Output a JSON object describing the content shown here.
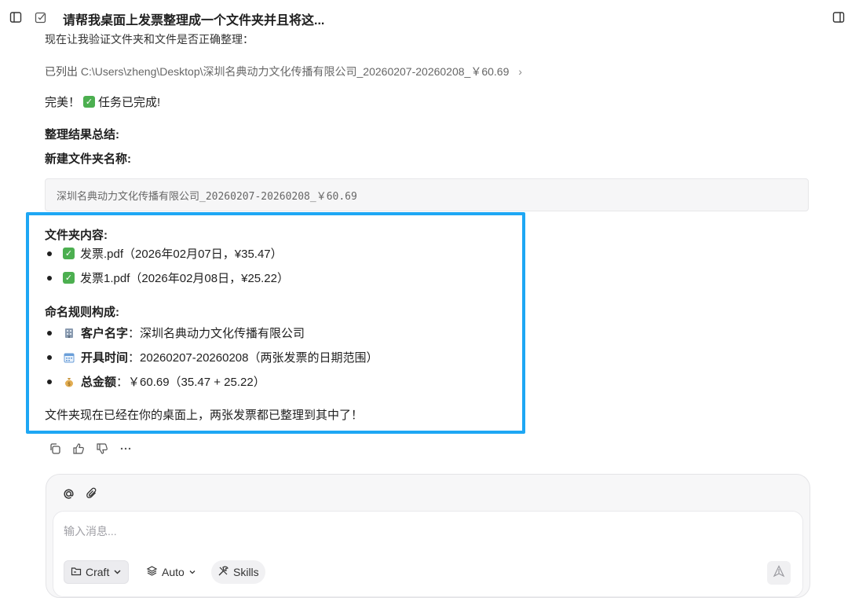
{
  "header": {
    "title": "请帮我桌面上发票整理成一个文件夹并且将这...",
    "icons": [
      "sidebar-toggle-icon",
      "edit-icon",
      "right-panel-icon"
    ]
  },
  "message": {
    "cut_line": "现在让我验证文件夹和文件是否正确整理：",
    "listed_label": "已列出",
    "listed_path": "C:\\Users\\zheng\\Desktop\\深圳名典动力文化传播有限公司_20260207-20260208_￥60.69",
    "done_text": "完美！",
    "done_task": "任务已完成!",
    "summary_heading": "整理结果总结:",
    "new_folder_heading": "新建文件夹名称:",
    "folder_name": "深圳名典动力文化传播有限公司_20260207-20260208_￥60.69",
    "contents_heading": "文件夹内容:",
    "files": [
      {
        "name": "发票.pdf",
        "detail": "（2026年02月07日，¥35.47）"
      },
      {
        "name": "发票1.pdf",
        "detail": "（2026年02月08日，¥25.22）"
      }
    ],
    "rules_heading": "命名规则构成:",
    "rules": [
      {
        "icon": "building-icon",
        "label": "客户名字",
        "value": "：深圳名典动力文化传播有限公司"
      },
      {
        "icon": "calendar-icon",
        "label": "开具时间",
        "value": "：20260207-20260208（两张发票的日期范围）"
      },
      {
        "icon": "money-bag-icon",
        "label": "总金额",
        "value": "：￥60.69（35.47 + 25.22）"
      }
    ],
    "final_text": "文件夹现在已经在你的桌面上，两张发票都已整理到其中了！"
  },
  "composer": {
    "placeholder": "输入消息...",
    "craft_label": "Craft",
    "auto_label": "Auto",
    "skills_label": "Skills"
  },
  "colors": {
    "highlight_border": "#1ea7f4",
    "check_green": "#4caf50"
  }
}
